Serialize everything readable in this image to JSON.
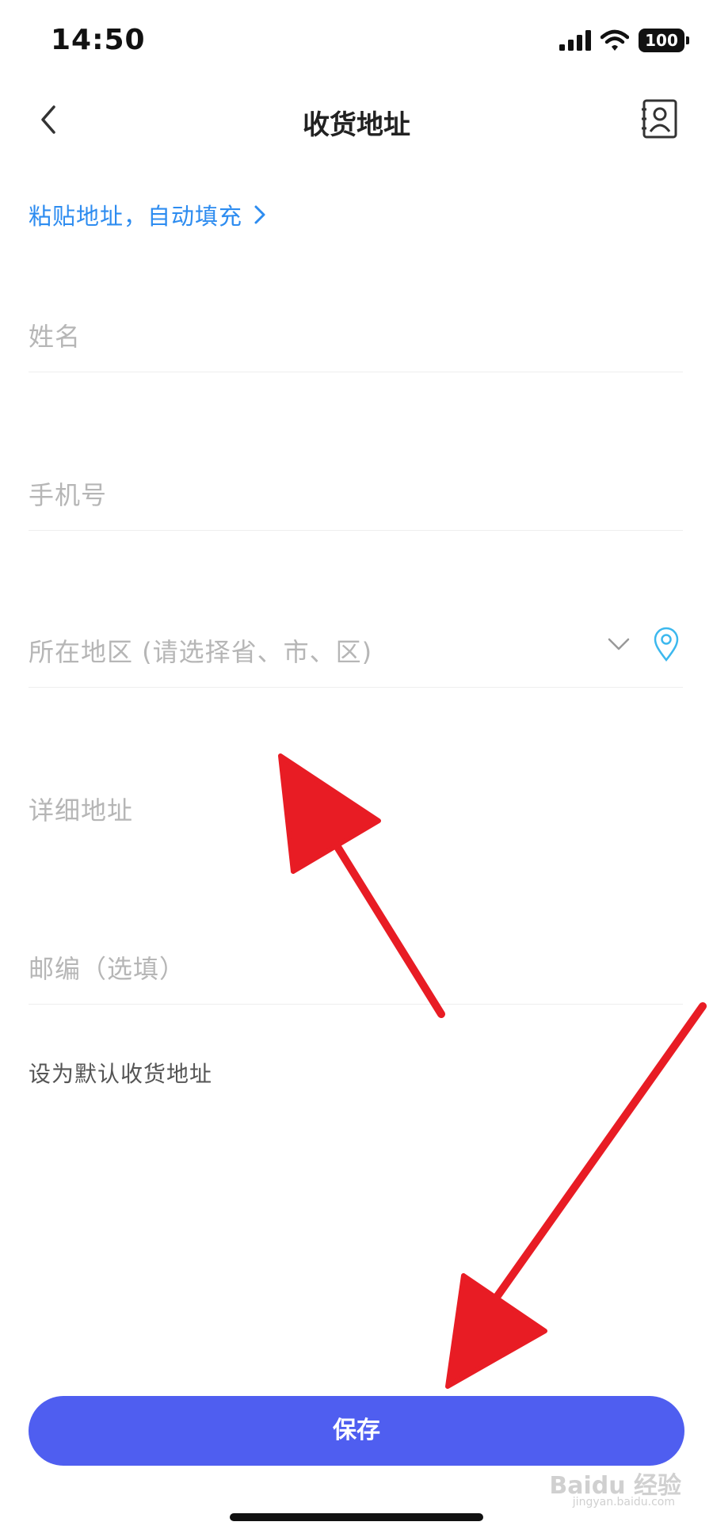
{
  "status_bar": {
    "time": "14:50",
    "battery": "100"
  },
  "nav": {
    "title": "收货地址",
    "back_icon": "chevron-left-icon",
    "contacts_icon": "address-book-icon"
  },
  "paste": {
    "label": "粘贴地址，自动填充",
    "icon": "chevron-right-icon",
    "color": "#2d8cf0"
  },
  "form": {
    "name_placeholder": "姓名",
    "phone_placeholder": "手机号",
    "region_placeholder": "所在地区 (请选择省、市、区)",
    "address_placeholder": "详细地址",
    "postcode_placeholder": "邮编（选填）",
    "default_label": "设为默认收货地址"
  },
  "actions": {
    "save_label": "保存",
    "save_color": "#4f5ef0"
  },
  "watermark": {
    "brand": "Baidu 经验",
    "site": "jingyan.baidu.com"
  },
  "annotation_color": "#e81c24"
}
